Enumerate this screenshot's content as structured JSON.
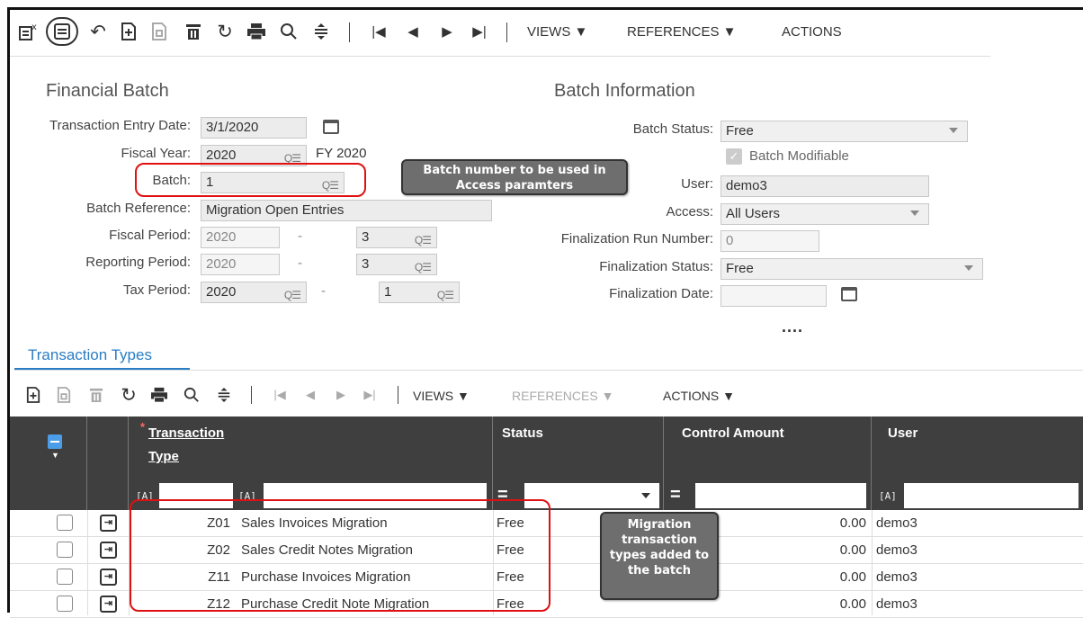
{
  "toolbar": {
    "views": "VIEWS ▼",
    "references": "REFERENCES ▼",
    "actions": "ACTIONS"
  },
  "form": {
    "title": "Financial Batch",
    "info_title": "Batch Information",
    "transaction_entry_date": {
      "label": "Transaction Entry Date:",
      "value": "3/1/2020"
    },
    "fiscal_year": {
      "label": "Fiscal Year:",
      "value": "2020",
      "description": "FY 2020"
    },
    "batch": {
      "label": "Batch:",
      "value": "1"
    },
    "batch_reference": {
      "label": "Batch Reference:",
      "value": "Migration Open Entries"
    },
    "fiscal_period": {
      "label": "Fiscal Period:",
      "year": "2020",
      "dash": "-",
      "period": "3"
    },
    "reporting_period": {
      "label": "Reporting Period:",
      "year": "2020",
      "dash": "-",
      "period": "3"
    },
    "tax_period": {
      "label": "Tax Period:",
      "year": "2020",
      "dash": "-",
      "period": "1"
    },
    "batch_status": {
      "label": "Batch Status:",
      "value": "Free"
    },
    "batch_modifiable": {
      "label": "Batch Modifiable",
      "checked": true
    },
    "user": {
      "label": "User:",
      "value": "demo3"
    },
    "access": {
      "label": "Access:",
      "value": "All Users"
    },
    "finalization_run_number": {
      "label": "Finalization Run Number:",
      "value": "0"
    },
    "finalization_status": {
      "label": "Finalization Status:",
      "value": "Free"
    },
    "finalization_date": {
      "label": "Finalization Date:",
      "value": ""
    },
    "more": "...."
  },
  "callouts": {
    "batch_note": "Batch number to be used in Access paramters",
    "migration_note": "Migration transaction types added to the batch"
  },
  "tab": {
    "label": "Transaction Types"
  },
  "grid_toolbar": {
    "views": "VIEWS ▼",
    "references": "REFERENCES ▼",
    "actions": "ACTIONS ▼"
  },
  "grid": {
    "columns": {
      "transaction_type_line1": "Transaction",
      "transaction_type_line2": "Type",
      "required_mark": "*",
      "status": "Status",
      "control_amount": "Control Amount",
      "user": "User"
    },
    "filter_tag": "[A]",
    "filter_eq": "=",
    "rows": [
      {
        "code": "Z01",
        "name": "Sales Invoices Migration",
        "status": "Free",
        "amount": "0.00",
        "user": "demo3"
      },
      {
        "code": "Z02",
        "name": "Sales Credit Notes Migration",
        "status": "Free",
        "amount": "0.00",
        "user": "demo3"
      },
      {
        "code": "Z11",
        "name": "Purchase Invoices Migration",
        "status": "Free",
        "amount": "0.00",
        "user": "demo3"
      },
      {
        "code": "Z12",
        "name": "Purchase Credit Note Migration",
        "status": "Free",
        "amount": "0.00",
        "user": "demo3"
      }
    ]
  },
  "colors": {
    "accent": "#2a7dc4",
    "highlight": "#e01010",
    "header_dark": "#3f3f3f"
  }
}
